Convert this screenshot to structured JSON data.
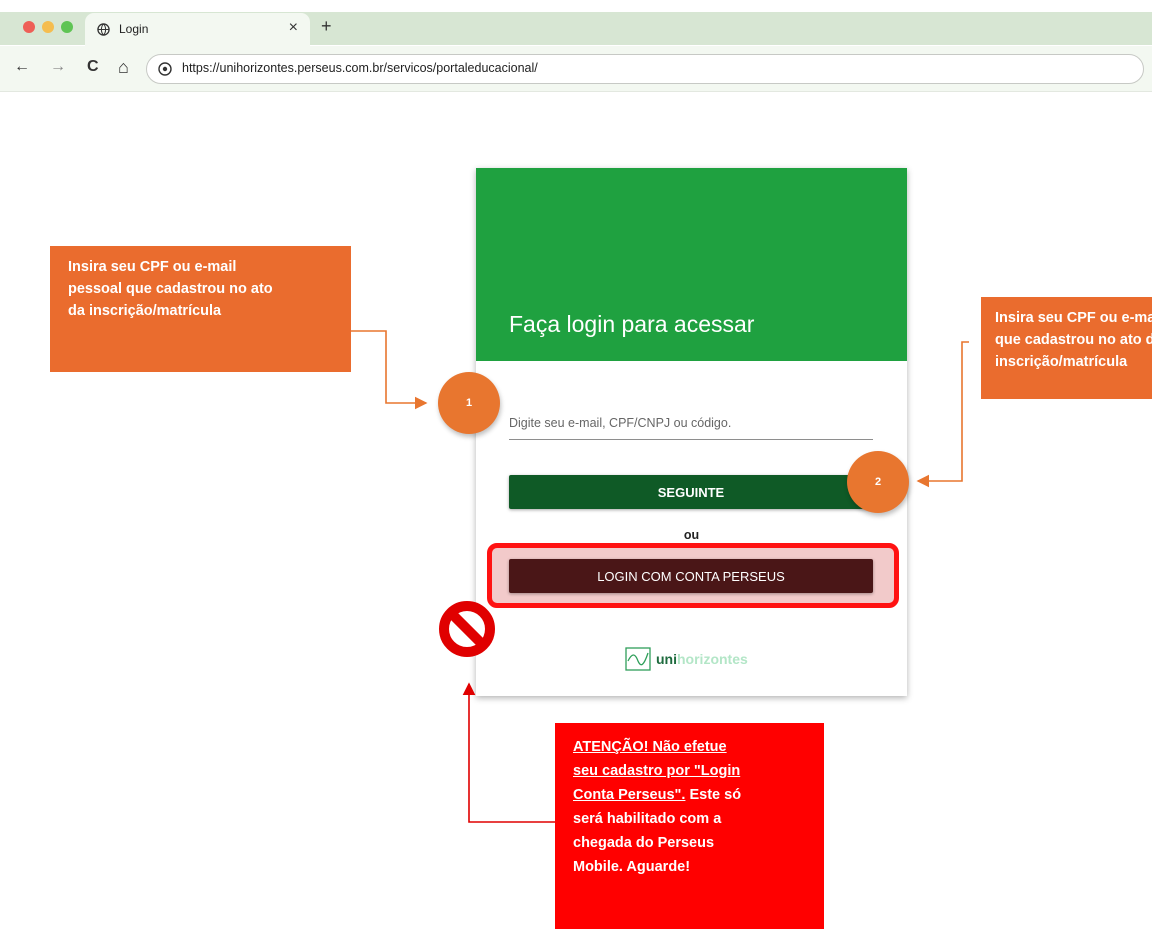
{
  "browser": {
    "tab_title": "Login",
    "tab_close": "×",
    "new_tab": "+",
    "nav_back": "←",
    "nav_forward": "→",
    "nav_reload": "C",
    "nav_home": "⌂",
    "url": "https://unihorizontes.perseus.com.br/servicos/portaleducacional/",
    "icons": [
      "globe-icon",
      "site-info-icon"
    ]
  },
  "login": {
    "title": "Faça login para acessar",
    "input_placeholder": "Digite seu e-mail, CPF/CNPJ ou código.",
    "next_button": "SEGUINTE",
    "or_text": "ou",
    "perseus_button": "LOGIN COM CONTA PERSEUS",
    "brand_prefix": "uni",
    "brand_suffix": "horizontes"
  },
  "annotations": {
    "left_callout": [
      "Insira seu CPF ou e-mail",
      "pessoal que cadastrou no ato",
      "da inscrição/matrícula"
    ],
    "right_callout": [
      "Insira seu CPF ou e-mail",
      "que cadastrou no ato da",
      "inscrição/matrícula"
    ],
    "badge_1": "1",
    "badge_2": "2",
    "warning_underlined": [
      "ATENÇÃO! Não efetue",
      "seu cadastro por \"Login",
      "Conta Perseus\"."
    ],
    "warning_rest_inline": " Este só",
    "warning_rest": [
      "será habilitado com a",
      "chegada do Perseus",
      "Mobile. Aguarde!"
    ]
  },
  "colors": {
    "header_green": "#1fa140",
    "next_button": "#0f5a26",
    "perseus_button": "#4a1617",
    "callout_orange": "#ea6c2e",
    "warning_red": "#ff0000"
  }
}
